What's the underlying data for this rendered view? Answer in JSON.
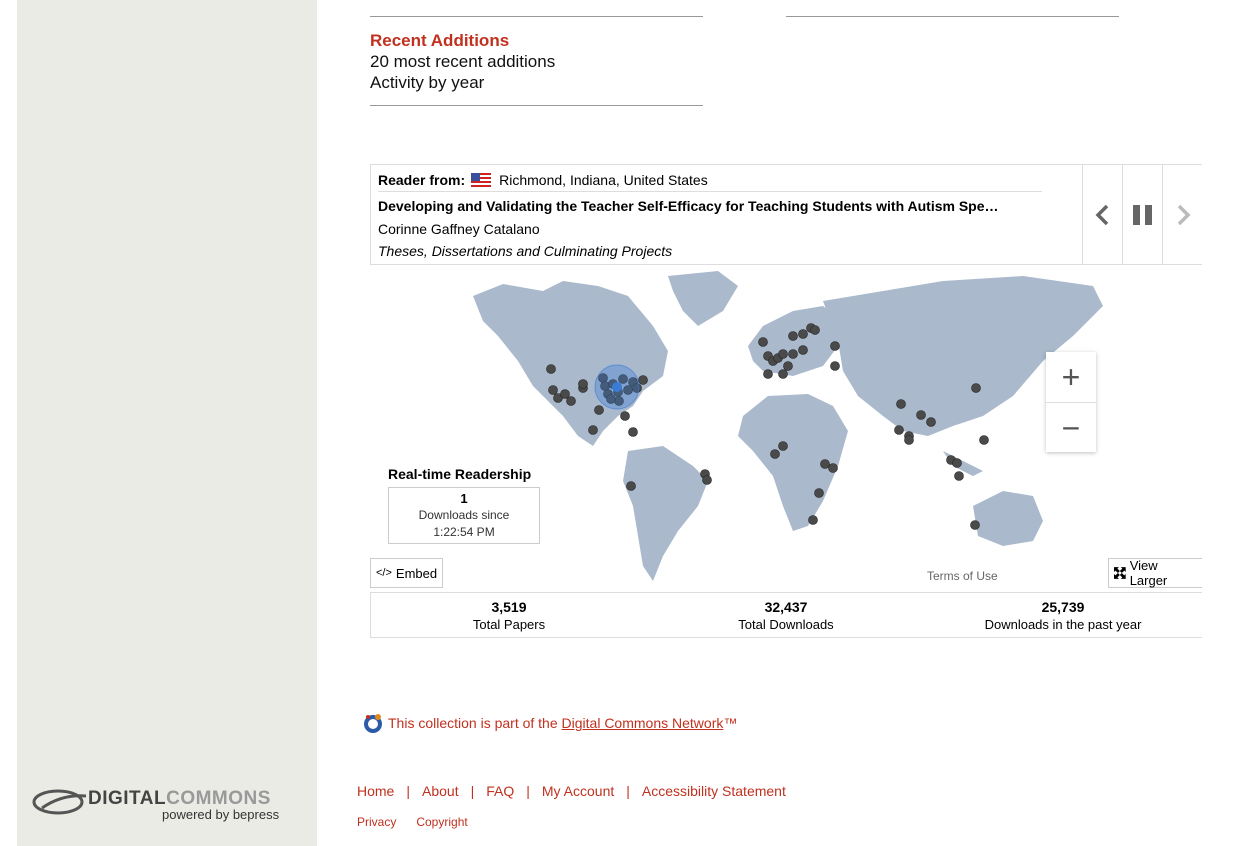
{
  "recent": {
    "title": "Recent Additions",
    "links": [
      "20 most recent additions",
      "Activity by year"
    ]
  },
  "reader": {
    "label": "Reader from:",
    "location": "Richmond, Indiana, United States",
    "title": "Developing and Validating the Teacher Self-Efficacy for Teaching Students with Autism Spe…",
    "author": "Corinne Gaffney Catalano",
    "collection": "Theses, Dissertations and Culminating Projects",
    "flag_icon": "us-flag-icon"
  },
  "map": {
    "zoom_in": "+",
    "zoom_out": "−",
    "terms": "Terms of Use",
    "land_color": "#aab9cc",
    "dot_color": "#4a4a4a",
    "highlight_color": "#3a7bd5"
  },
  "realtime": {
    "title": "Real-time Readership",
    "count": "1",
    "line1": "Downloads since",
    "line2": "1:22:54 PM"
  },
  "buttons": {
    "embed": "Embed",
    "view_larger": "View Larger"
  },
  "stats": [
    {
      "value": "3,519",
      "label": "Total Papers"
    },
    {
      "value": "32,437",
      "label": "Total Downloads"
    },
    {
      "value": "25,739",
      "label": "Downloads in the past year"
    }
  ],
  "network": {
    "prefix": "This collection is part of the ",
    "link": "Digital Commons Network",
    "suffix": "™"
  },
  "footer": {
    "links": [
      "Home",
      "About",
      "FAQ",
      "My Account",
      "Accessibility Statement"
    ],
    "small_links": [
      "Privacy",
      "Copyright"
    ]
  },
  "logo": {
    "main_a": "DIGITAL",
    "main_b": "COMMONS",
    "sub": "powered by bepress"
  }
}
